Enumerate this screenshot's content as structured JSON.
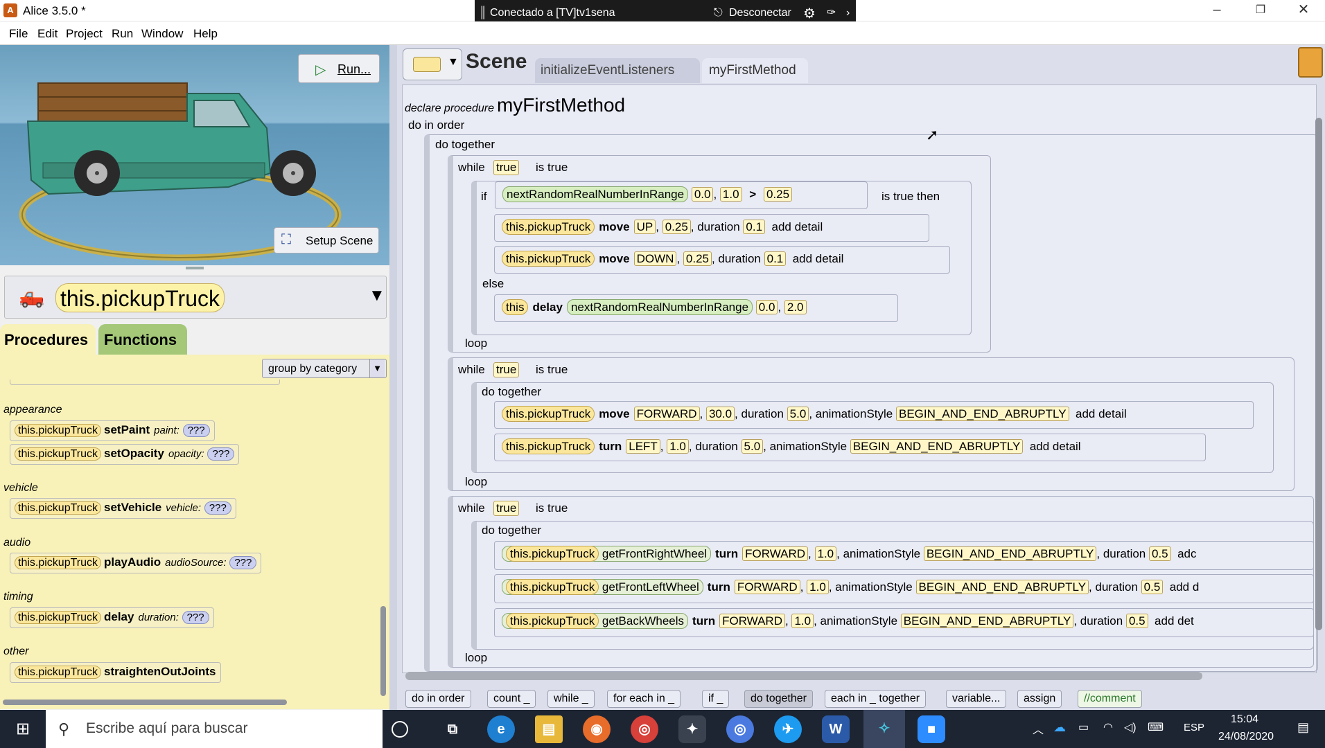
{
  "window": {
    "title": "Alice 3.5.0  *",
    "app_icon_letter": "A",
    "minimize_icon": "minimize-icon",
    "maximize_icon": "restore-icon",
    "close_icon": "close-icon"
  },
  "teamviewer": {
    "connection": "Conectado a [TV]tv1sena",
    "disconnect": "Desconectar"
  },
  "menu": [
    "File",
    "Edit",
    "Project",
    "Run",
    "Window",
    "Help"
  ],
  "scene_view": {
    "run_label": "Run...",
    "setup_scene_label": "Setup Scene"
  },
  "object_selector": {
    "selected": "this.pickupTruck"
  },
  "left_tabs": {
    "procedures": "Procedures",
    "functions": "Functions"
  },
  "group_select": "group by category",
  "categories": {
    "appearance": "appearance",
    "vehicle": "vehicle",
    "audio": "audio",
    "timing": "timing",
    "other": "other"
  },
  "procedures": [
    {
      "obj": "this.pickupTruck",
      "method": "setPaint",
      "param": "paint:",
      "value": "???"
    },
    {
      "obj": "this.pickupTruck",
      "method": "setOpacity",
      "param": "opacity:",
      "value": "???"
    },
    {
      "obj": "this.pickupTruck",
      "method": "setVehicle",
      "param": "vehicle:",
      "value": "???"
    },
    {
      "obj": "this.pickupTruck",
      "method": "playAudio",
      "param": "audioSource:",
      "value": "???"
    },
    {
      "obj": "this.pickupTruck",
      "method": "delay",
      "param": "duration:",
      "value": "???"
    },
    {
      "obj": "this.pickupTruck",
      "method": "straightenOutJoints",
      "param": "",
      "value": ""
    }
  ],
  "editor_tabs": {
    "scene": "Scene",
    "init": "initializeEventListeners",
    "method": "myFirstMethod"
  },
  "declare": {
    "prefix": "declare procedure",
    "name": "myFirstMethod"
  },
  "code": {
    "do_in_order": "do in order",
    "do_together": "do together",
    "while": "while",
    "true": "true",
    "is_true": "is true",
    "if": "if",
    "is_true_then": "is true then",
    "else": "else",
    "loop": "loop",
    "this_pickup": "this.pickupTruck",
    "this": "this",
    "move": "move",
    "turn": "turn",
    "delay": "delay",
    "random_fn": "nextRandomRealNumberInRange",
    "gt": ">",
    "duration": ", duration",
    "anim_style": ", animationStyle",
    "add_detail": "add detail",
    "up": "UP",
    "down": "DOWN",
    "forward": "FORWARD",
    "left": "LEFT",
    "begin_end": "BEGIN_AND_END_ABRUPTLY",
    "front_right": "getFrontRightWheel",
    "front_left": "getFrontLeftWheel",
    "back_wheels": "getBackWheels",
    "v00": "0.0",
    "v10": "1.0",
    "v025": "0.25",
    "v01": "0.1",
    "v20": "2.0",
    "v300": "30.0",
    "v50": "5.0",
    "v05": "0.5",
    "add_trunc1": "adc",
    "add_trunc2": "add d",
    "add_trunc3": "add det"
  },
  "bottom_bar": [
    "do in order",
    "count _",
    "while _",
    "for each in _",
    "if _",
    "do together",
    "each in _ together",
    "variable...",
    "assign",
    "//comment"
  ],
  "taskbar": {
    "search_placeholder": "Escribe aquí para buscar",
    "lang": "ESP",
    "time": "15:04",
    "date": "24/08/2020",
    "apps": [
      "cortana-icon",
      "task-view-icon",
      "edge-icon",
      "file-explorer-icon",
      "firefox-icon",
      "chrome-icon",
      "game-icon",
      "chromium-icon",
      "twitter-icon",
      "word-icon",
      "alice-icon",
      "zoom-icon"
    ]
  },
  "colors": {
    "procedures_bg": "#f8f1b8",
    "functions_tab": "#a4c878",
    "object_chip": "#fbe79c",
    "editor_bg": "#e9ebf5",
    "taskbar": "#1d2533"
  }
}
